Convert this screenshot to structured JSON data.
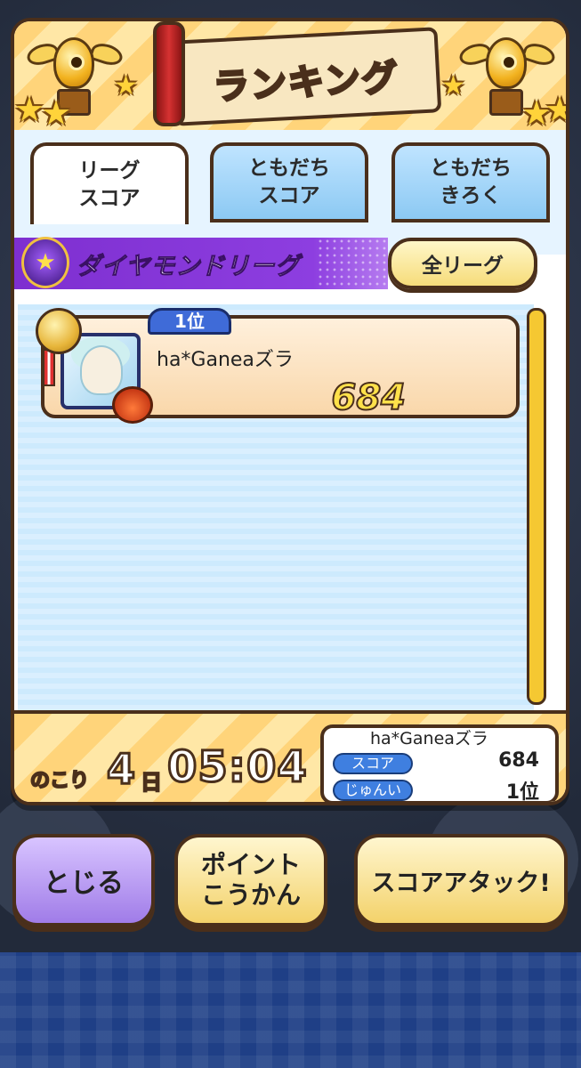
{
  "header": {
    "title": "ランキング"
  },
  "tabs": [
    {
      "label": "リーグ\nスコア",
      "active": true
    },
    {
      "label": "ともだち\nスコア",
      "active": false
    },
    {
      "label": "ともだち\nきろく",
      "active": false
    }
  ],
  "league": {
    "title": "ダイヤモンドリーグ",
    "all_league_button": "全リーグ"
  },
  "ranking": [
    {
      "rank": "1位",
      "name": "ha*Ganeaズラ",
      "score": "684"
    }
  ],
  "footer": {
    "remaining_label": "のこり",
    "remaining_days": "4",
    "remaining_days_unit": "日",
    "remaining_time": "05:04",
    "my_name": "ha*Ganeaズラ",
    "score_label": "スコア",
    "score_value": "684",
    "rank_label": "じゅんい",
    "rank_value": "1位"
  },
  "buttons": {
    "close": "とじる",
    "points": "ポイント\nこうかん",
    "score_attack": "スコアアタック!"
  },
  "icons": {
    "trophy": "winged-trophy-icon",
    "star": "star-icon",
    "league_emblem": "diamond-league-emblem-icon",
    "medal": "gold-medal-icon"
  },
  "colors": {
    "accent_purple": "#8d3ee0",
    "accent_yellow": "#ffe14a",
    "outline_brown": "#4a2f1b",
    "tab_blue": "#8cc9f3"
  }
}
